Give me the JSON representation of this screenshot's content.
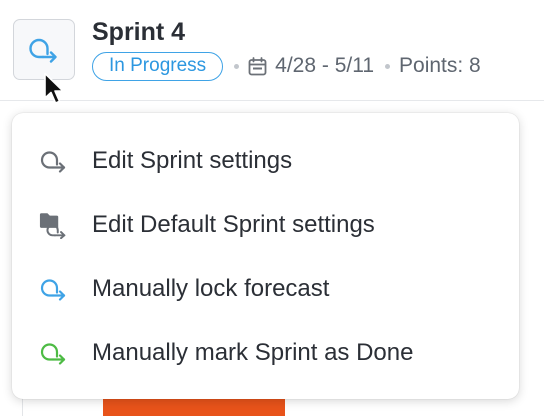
{
  "header": {
    "title": "Sprint 4",
    "status": "In Progress",
    "date_range": "4/28 - 5/11",
    "points": "Points: 8",
    "sprint_icon": "sprint-loop-arrow-icon",
    "calendar_icon": "calendar-icon"
  },
  "menu": {
    "items": [
      {
        "label": "Edit Sprint settings",
        "icon": "sprint-loop-arrow-icon",
        "color": "#6b7077"
      },
      {
        "label": "Edit Default Sprint settings",
        "icon": "folder-loop-arrow-icon",
        "color": "#6b7077"
      },
      {
        "label": "Manually lock forecast",
        "icon": "sprint-loop-arrow-icon",
        "color": "#3fa3e6"
      },
      {
        "label": "Manually mark Sprint as Done",
        "icon": "sprint-loop-arrow-icon",
        "color": "#4dbb44"
      }
    ]
  },
  "colors": {
    "accent_blue": "#3fa3e6",
    "done_green": "#4dbb44",
    "bar_orange": "#e8531a"
  }
}
